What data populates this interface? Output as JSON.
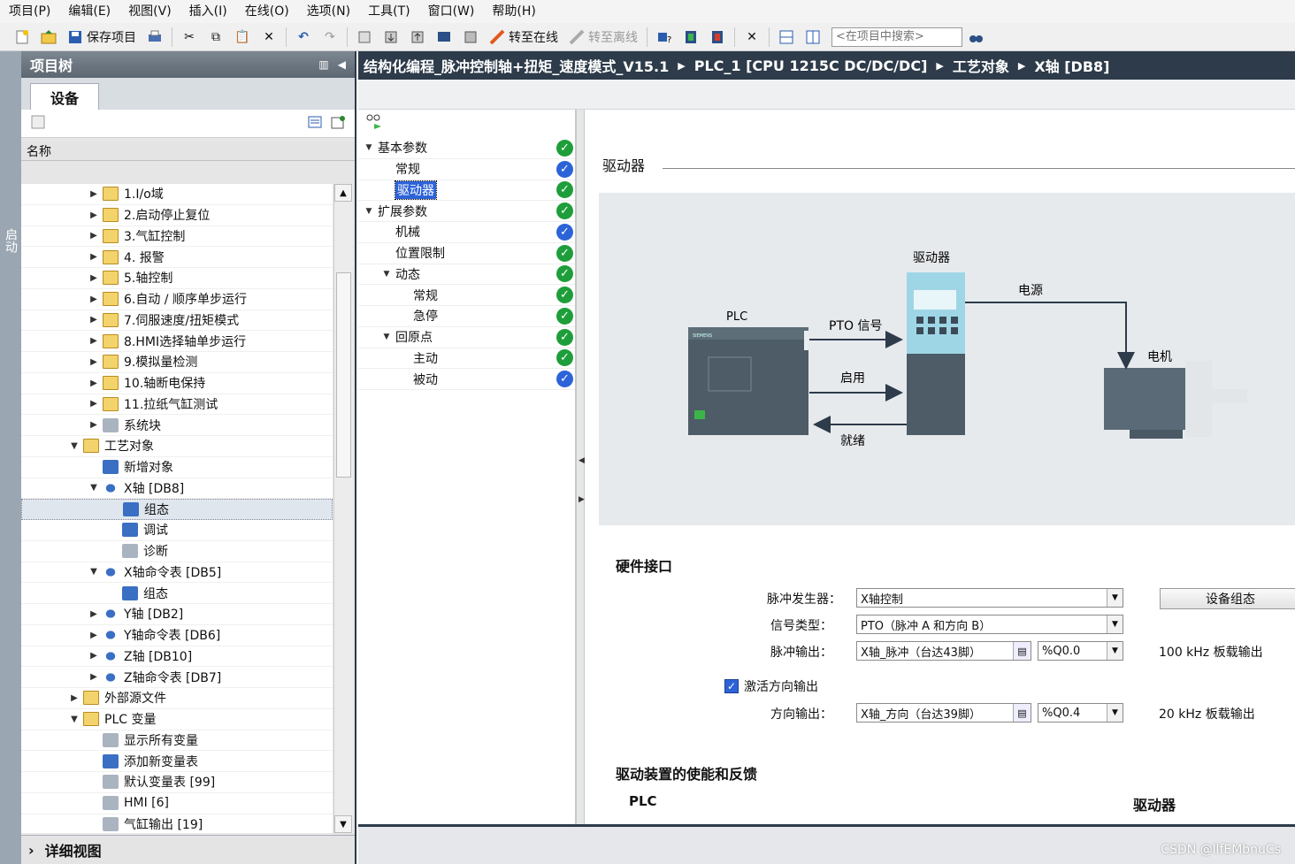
{
  "menu": [
    "项目(P)",
    "编辑(E)",
    "视图(V)",
    "插入(I)",
    "在线(O)",
    "选项(N)",
    "工具(T)",
    "窗口(W)",
    "帮助(H)"
  ],
  "toolbar": {
    "save_label": "保存项目",
    "go_online": "转至在线",
    "go_offline": "转至离线",
    "search_placeholder": "<在项目中搜索>"
  },
  "sidetab": {
    "label": "启动"
  },
  "tree": {
    "title": "项目树",
    "tab": "设备",
    "column": "名称",
    "footer": "详细视图",
    "items": [
      {
        "label": "1.I/o域"
      },
      {
        "label": "2.启动停止复位"
      },
      {
        "label": "3.气缸控制"
      },
      {
        "label": "4. 报警"
      },
      {
        "label": "5.轴控制"
      },
      {
        "label": "6.自动 / 顺序单步运行"
      },
      {
        "label": "7.伺服速度/扭矩模式"
      },
      {
        "label": "8.HMI选择轴单步运行"
      },
      {
        "label": "9.模拟量检测"
      },
      {
        "label": "10.轴断电保持"
      },
      {
        "label": "11.拉纸气缸测试"
      },
      {
        "label": "系统块"
      },
      {
        "label": "工艺对象"
      },
      {
        "label": "新增对象"
      },
      {
        "label": "X轴 [DB8]"
      },
      {
        "label": "组态"
      },
      {
        "label": "调试"
      },
      {
        "label": "诊断"
      },
      {
        "label": "X轴命令表 [DB5]"
      },
      {
        "label": "组态"
      },
      {
        "label": "Y轴 [DB2]"
      },
      {
        "label": "Y轴命令表 [DB6]"
      },
      {
        "label": "Z轴 [DB10]"
      },
      {
        "label": "Z轴命令表 [DB7]"
      },
      {
        "label": "外部源文件"
      },
      {
        "label": "PLC 变量"
      },
      {
        "label": "显示所有变量"
      },
      {
        "label": "添加新变量表"
      },
      {
        "label": "默认变量表 [99]"
      },
      {
        "label": "HMI [6]"
      },
      {
        "label": "气缸输出 [19]"
      }
    ]
  },
  "breadcrumb": [
    "结构化编程_脉冲控制轴+扭矩_速度模式_V15.1",
    "PLC_1 [CPU 1215C DC/DC/DC]",
    "工艺对象",
    "X轴 [DB8]"
  ],
  "nav": {
    "items": [
      {
        "label": "基本参数",
        "status": "ok"
      },
      {
        "label": "常规",
        "status": "info"
      },
      {
        "label": "驱动器",
        "status": "ok"
      },
      {
        "label": "扩展参数",
        "status": "ok"
      },
      {
        "label": "机械",
        "status": "info"
      },
      {
        "label": "位置限制",
        "status": "ok"
      },
      {
        "label": "动态",
        "status": "ok"
      },
      {
        "label": "常规",
        "status": "ok"
      },
      {
        "label": "急停",
        "status": "ok"
      },
      {
        "label": "回原点",
        "status": "ok"
      },
      {
        "label": "主动",
        "status": "ok"
      },
      {
        "label": "被动",
        "status": "info"
      }
    ]
  },
  "content": {
    "section_title": "驱动器",
    "diagram": {
      "plc": "PLC",
      "drive": "驱动器",
      "power": "电源",
      "motor": "电机",
      "pto": "PTO 信号",
      "enable": "启用",
      "ready": "就绪",
      "brand": "SIEMENS"
    },
    "hw_title": "硬件接口",
    "pulse_gen_label": "脉冲发生器：",
    "pulse_gen_value": "X轴控制",
    "device_config_btn": "设备组态",
    "signal_type_label": "信号类型：",
    "signal_type_value": "PTO（脉冲 A 和方向 B）",
    "pulse_out_label": "脉冲输出：",
    "pulse_out_value": "X轴_脉冲（台达43脚）",
    "pulse_out_addr": "%Q0.0",
    "pulse_out_note": "100 kHz 板载输出",
    "dir_check_label": "激活方向输出",
    "dir_check_checked": true,
    "dir_out_label": "方向输出：",
    "dir_out_value": "X轴_方向（台达39脚）",
    "dir_out_addr": "%Q0.4",
    "dir_out_note": "20 kHz 板载输出",
    "enable_title": "驱动装置的使能和反馈",
    "enable_plc": "PLC",
    "enable_drive": "驱动器"
  },
  "watermark": "CSDN @llfEMbnuCs",
  "colors": {
    "breadcrumb_bg": "#2d3b4a",
    "ok_green": "#1e9e3a",
    "info_blue": "#2d63d8",
    "diagram_bg": "#e7eaed"
  }
}
